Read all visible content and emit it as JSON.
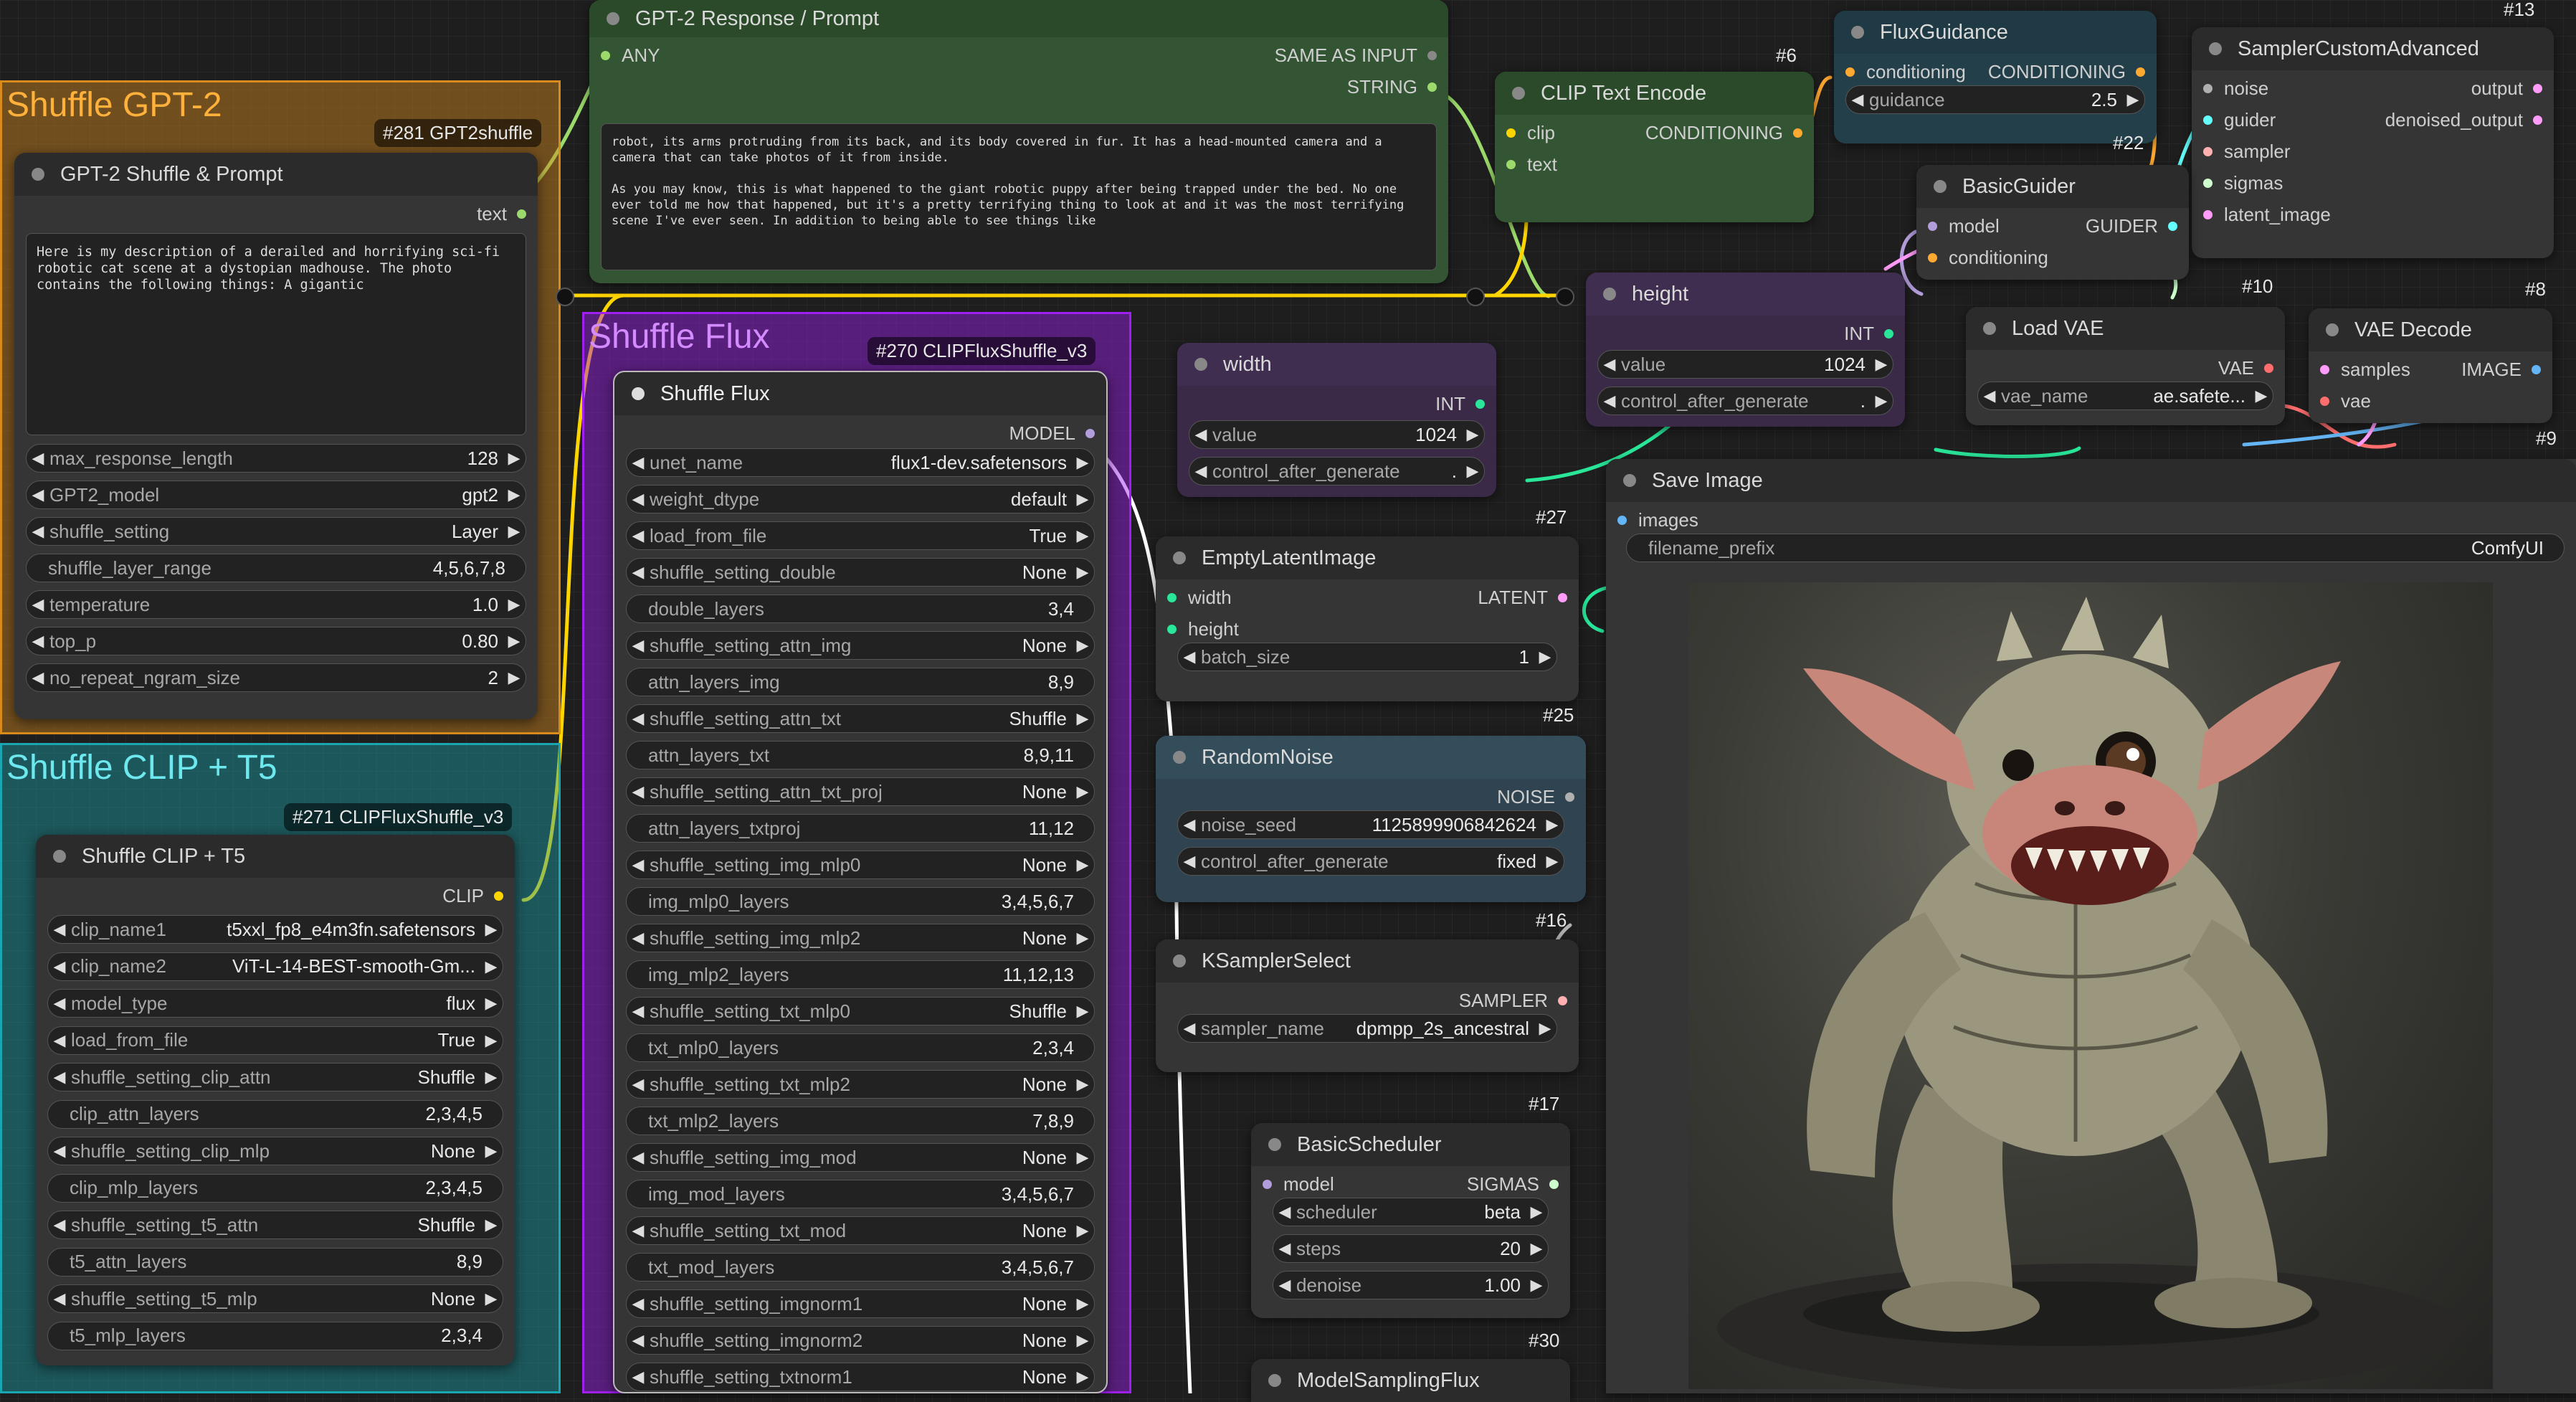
{
  "groups": {
    "gpt2": {
      "title": "Shuffle GPT-2"
    },
    "clip_t5": {
      "title": "Shuffle CLIP + T5"
    },
    "flux": {
      "title": "Shuffle Flux"
    }
  },
  "nodes": {
    "gpt2_shuffle": {
      "id_badge": "#281 GPT2shuffle",
      "title": "GPT-2 Shuffle & Prompt",
      "output_text": "text",
      "prompt_text": "Here is my description of a derailed and horrifying sci-fi robotic cat scene at a dystopian madhouse. The photo contains the following things: A gigantic",
      "widgets": [
        {
          "label": "max_response_length",
          "value": "128"
        },
        {
          "label": "GPT2_model",
          "value": "gpt2"
        },
        {
          "label": "shuffle_setting",
          "value": "Layer"
        },
        {
          "label": "shuffle_layer_range",
          "value": "4,5,6,7,8"
        },
        {
          "label": "temperature",
          "value": "1.0"
        },
        {
          "label": "top_p",
          "value": "0.80"
        },
        {
          "label": "no_repeat_ngram_size",
          "value": "2"
        }
      ]
    },
    "gpt2_response": {
      "title": "GPT-2 Response / Prompt",
      "input_any": "ANY",
      "output_same": "SAME AS INPUT",
      "output_string": "STRING",
      "text": "robot, its arms protruding from its back, and its body covered in fur. It has a head-mounted camera and a camera that can take photos of it from inside.\n\nAs you may know, this is what happened to the giant robotic puppy after being trapped under the bed. No one ever told me how that happened, but it's a pretty terrifying thing to look at and it was the most terrifying scene I've ever seen. In addition to being able to see things like"
    },
    "clip_shuffle": {
      "id_badge": "#271 CLIPFluxShuffle_v3",
      "title": "Shuffle CLIP + T5",
      "output_clip": "CLIP",
      "widgets": [
        {
          "label": "clip_name1",
          "value": "t5xxl_fp8_e4m3fn.safetensors"
        },
        {
          "label": "clip_name2",
          "value": "ViT-L-14-BEST-smooth-Gm..."
        },
        {
          "label": "model_type",
          "value": "flux"
        },
        {
          "label": "load_from_file",
          "value": "True"
        },
        {
          "label": "shuffle_setting_clip_attn",
          "value": "Shuffle"
        },
        {
          "label": "clip_attn_layers",
          "value": "2,3,4,5"
        },
        {
          "label": "shuffle_setting_clip_mlp",
          "value": "None"
        },
        {
          "label": "clip_mlp_layers",
          "value": "2,3,4,5"
        },
        {
          "label": "shuffle_setting_t5_attn",
          "value": "Shuffle"
        },
        {
          "label": "t5_attn_layers",
          "value": "8,9"
        },
        {
          "label": "shuffle_setting_t5_mlp",
          "value": "None"
        },
        {
          "label": "t5_mlp_layers",
          "value": "2,3,4"
        }
      ]
    },
    "flux_shuffle": {
      "id_badge": "#270 CLIPFluxShuffle_v3",
      "title": "Shuffle Flux",
      "output_model": "MODEL",
      "widgets": [
        {
          "label": "unet_name",
          "value": "flux1-dev.safetensors"
        },
        {
          "label": "weight_dtype",
          "value": "default"
        },
        {
          "label": "load_from_file",
          "value": "True"
        },
        {
          "label": "shuffle_setting_double",
          "value": "None"
        },
        {
          "label": "double_layers",
          "value": "3,4"
        },
        {
          "label": "shuffle_setting_attn_img",
          "value": "None"
        },
        {
          "label": "attn_layers_img",
          "value": "8,9"
        },
        {
          "label": "shuffle_setting_attn_txt",
          "value": "Shuffle"
        },
        {
          "label": "attn_layers_txt",
          "value": "8,9,11"
        },
        {
          "label": "shuffle_setting_attn_txt_proj",
          "value": "None"
        },
        {
          "label": "attn_layers_txtproj",
          "value": "11,12"
        },
        {
          "label": "shuffle_setting_img_mlp0",
          "value": "None"
        },
        {
          "label": "img_mlp0_layers",
          "value": "3,4,5,6,7"
        },
        {
          "label": "shuffle_setting_img_mlp2",
          "value": "None"
        },
        {
          "label": "img_mlp2_layers",
          "value": "11,12,13"
        },
        {
          "label": "shuffle_setting_txt_mlp0",
          "value": "Shuffle"
        },
        {
          "label": "txt_mlp0_layers",
          "value": "2,3,4"
        },
        {
          "label": "shuffle_setting_txt_mlp2",
          "value": "None"
        },
        {
          "label": "txt_mlp2_layers",
          "value": "7,8,9"
        },
        {
          "label": "shuffle_setting_img_mod",
          "value": "None"
        },
        {
          "label": "img_mod_layers",
          "value": "3,4,5,6,7"
        },
        {
          "label": "shuffle_setting_txt_mod",
          "value": "None"
        },
        {
          "label": "txt_mod_layers",
          "value": "3,4,5,6,7"
        },
        {
          "label": "shuffle_setting_imgnorm1",
          "value": "None"
        },
        {
          "label": "shuffle_setting_imgnorm2",
          "value": "None"
        },
        {
          "label": "shuffle_setting_txtnorm1",
          "value": "None"
        }
      ]
    },
    "clip_text_encode": {
      "id_badge": "#6",
      "title": "CLIP Text Encode",
      "input_clip": "clip",
      "input_text": "text",
      "output": "CONDITIONING"
    },
    "flux_guidance": {
      "id_badge": "#22",
      "title": "FluxGuidance",
      "input": "conditioning",
      "output": "CONDITIONING",
      "widget": {
        "label": "guidance",
        "value": "2.5"
      }
    },
    "sampler_custom": {
      "id_badge": "#13",
      "title": "SamplerCustomAdvanced",
      "inputs": [
        "noise",
        "guider",
        "sampler",
        "sigmas",
        "latent_image"
      ],
      "outputs": [
        "output",
        "denoised_output"
      ]
    },
    "basic_guider": {
      "id_badge": "#10",
      "title": "BasicGuider",
      "input_model": "model",
      "input_conditioning": "conditioning",
      "output": "GUIDER"
    },
    "height": {
      "id_badge": "#27",
      "title": "height",
      "output": "INT",
      "widgets": [
        {
          "label": "value",
          "value": "1024"
        },
        {
          "label": "control_after_generate",
          "value": "."
        }
      ]
    },
    "width": {
      "title": "width",
      "output": "INT",
      "widgets": [
        {
          "label": "value",
          "value": "1024"
        },
        {
          "label": "control_after_generate",
          "value": "."
        }
      ]
    },
    "load_vae": {
      "id_badge": "#8",
      "title": "Load VAE",
      "output": "VAE",
      "widget": {
        "label": "vae_name",
        "value": "ae.safete..."
      }
    },
    "vae_decode": {
      "id_badge": "#9",
      "title": "VAE Decode",
      "input_samples": "samples",
      "input_vae": "vae",
      "output": "IMAGE"
    },
    "save_image": {
      "title": "Save Image",
      "input_images": "images",
      "widget": {
        "label": "filename_prefix",
        "value": "ComfyUI"
      }
    },
    "empty_latent": {
      "id_badge": "#25",
      "title": "EmptyLatentImage",
      "input_width": "width",
      "input_height": "height",
      "output": "LATENT",
      "widget": {
        "label": "batch_size",
        "value": "1"
      }
    },
    "random_noise": {
      "id_badge": "#16",
      "title": "RandomNoise",
      "output": "NOISE",
      "widgets": [
        {
          "label": "noise_seed",
          "value": "1125899906842624"
        },
        {
          "label": "control_after_generate",
          "value": "fixed"
        }
      ]
    },
    "ksampler_select": {
      "id_badge": "#17",
      "title": "KSamplerSelect",
      "output": "SAMPLER",
      "widget": {
        "label": "sampler_name",
        "value": "dpmpp_2s_ancestral"
      }
    },
    "basic_scheduler": {
      "id_badge": "#30",
      "title": "BasicScheduler",
      "input_model": "model",
      "output": "SIGMAS",
      "widgets": [
        {
          "label": "scheduler",
          "value": "beta"
        },
        {
          "label": "steps",
          "value": "20"
        },
        {
          "label": "denoise",
          "value": "1.00"
        }
      ]
    },
    "model_sampling_flux": {
      "title": "ModelSamplingFlux"
    }
  },
  "colors": {
    "clip": "#ffd500",
    "conditioning": "#ffa931",
    "model": "#b39ddb",
    "vae": "#ff6e6e",
    "latent": "#ff9cf9",
    "image": "#64b5f6",
    "int": "#29e699",
    "string": "#9cdb6b",
    "noise": "#b0b0b0",
    "sampler": "#ffb0b0",
    "sigmas": "#cdffcd",
    "guider": "#66ffff",
    "group_gpt2": "#d88a1c",
    "group_clip": "#1aa6b0",
    "group_flux": "#a020f0"
  }
}
